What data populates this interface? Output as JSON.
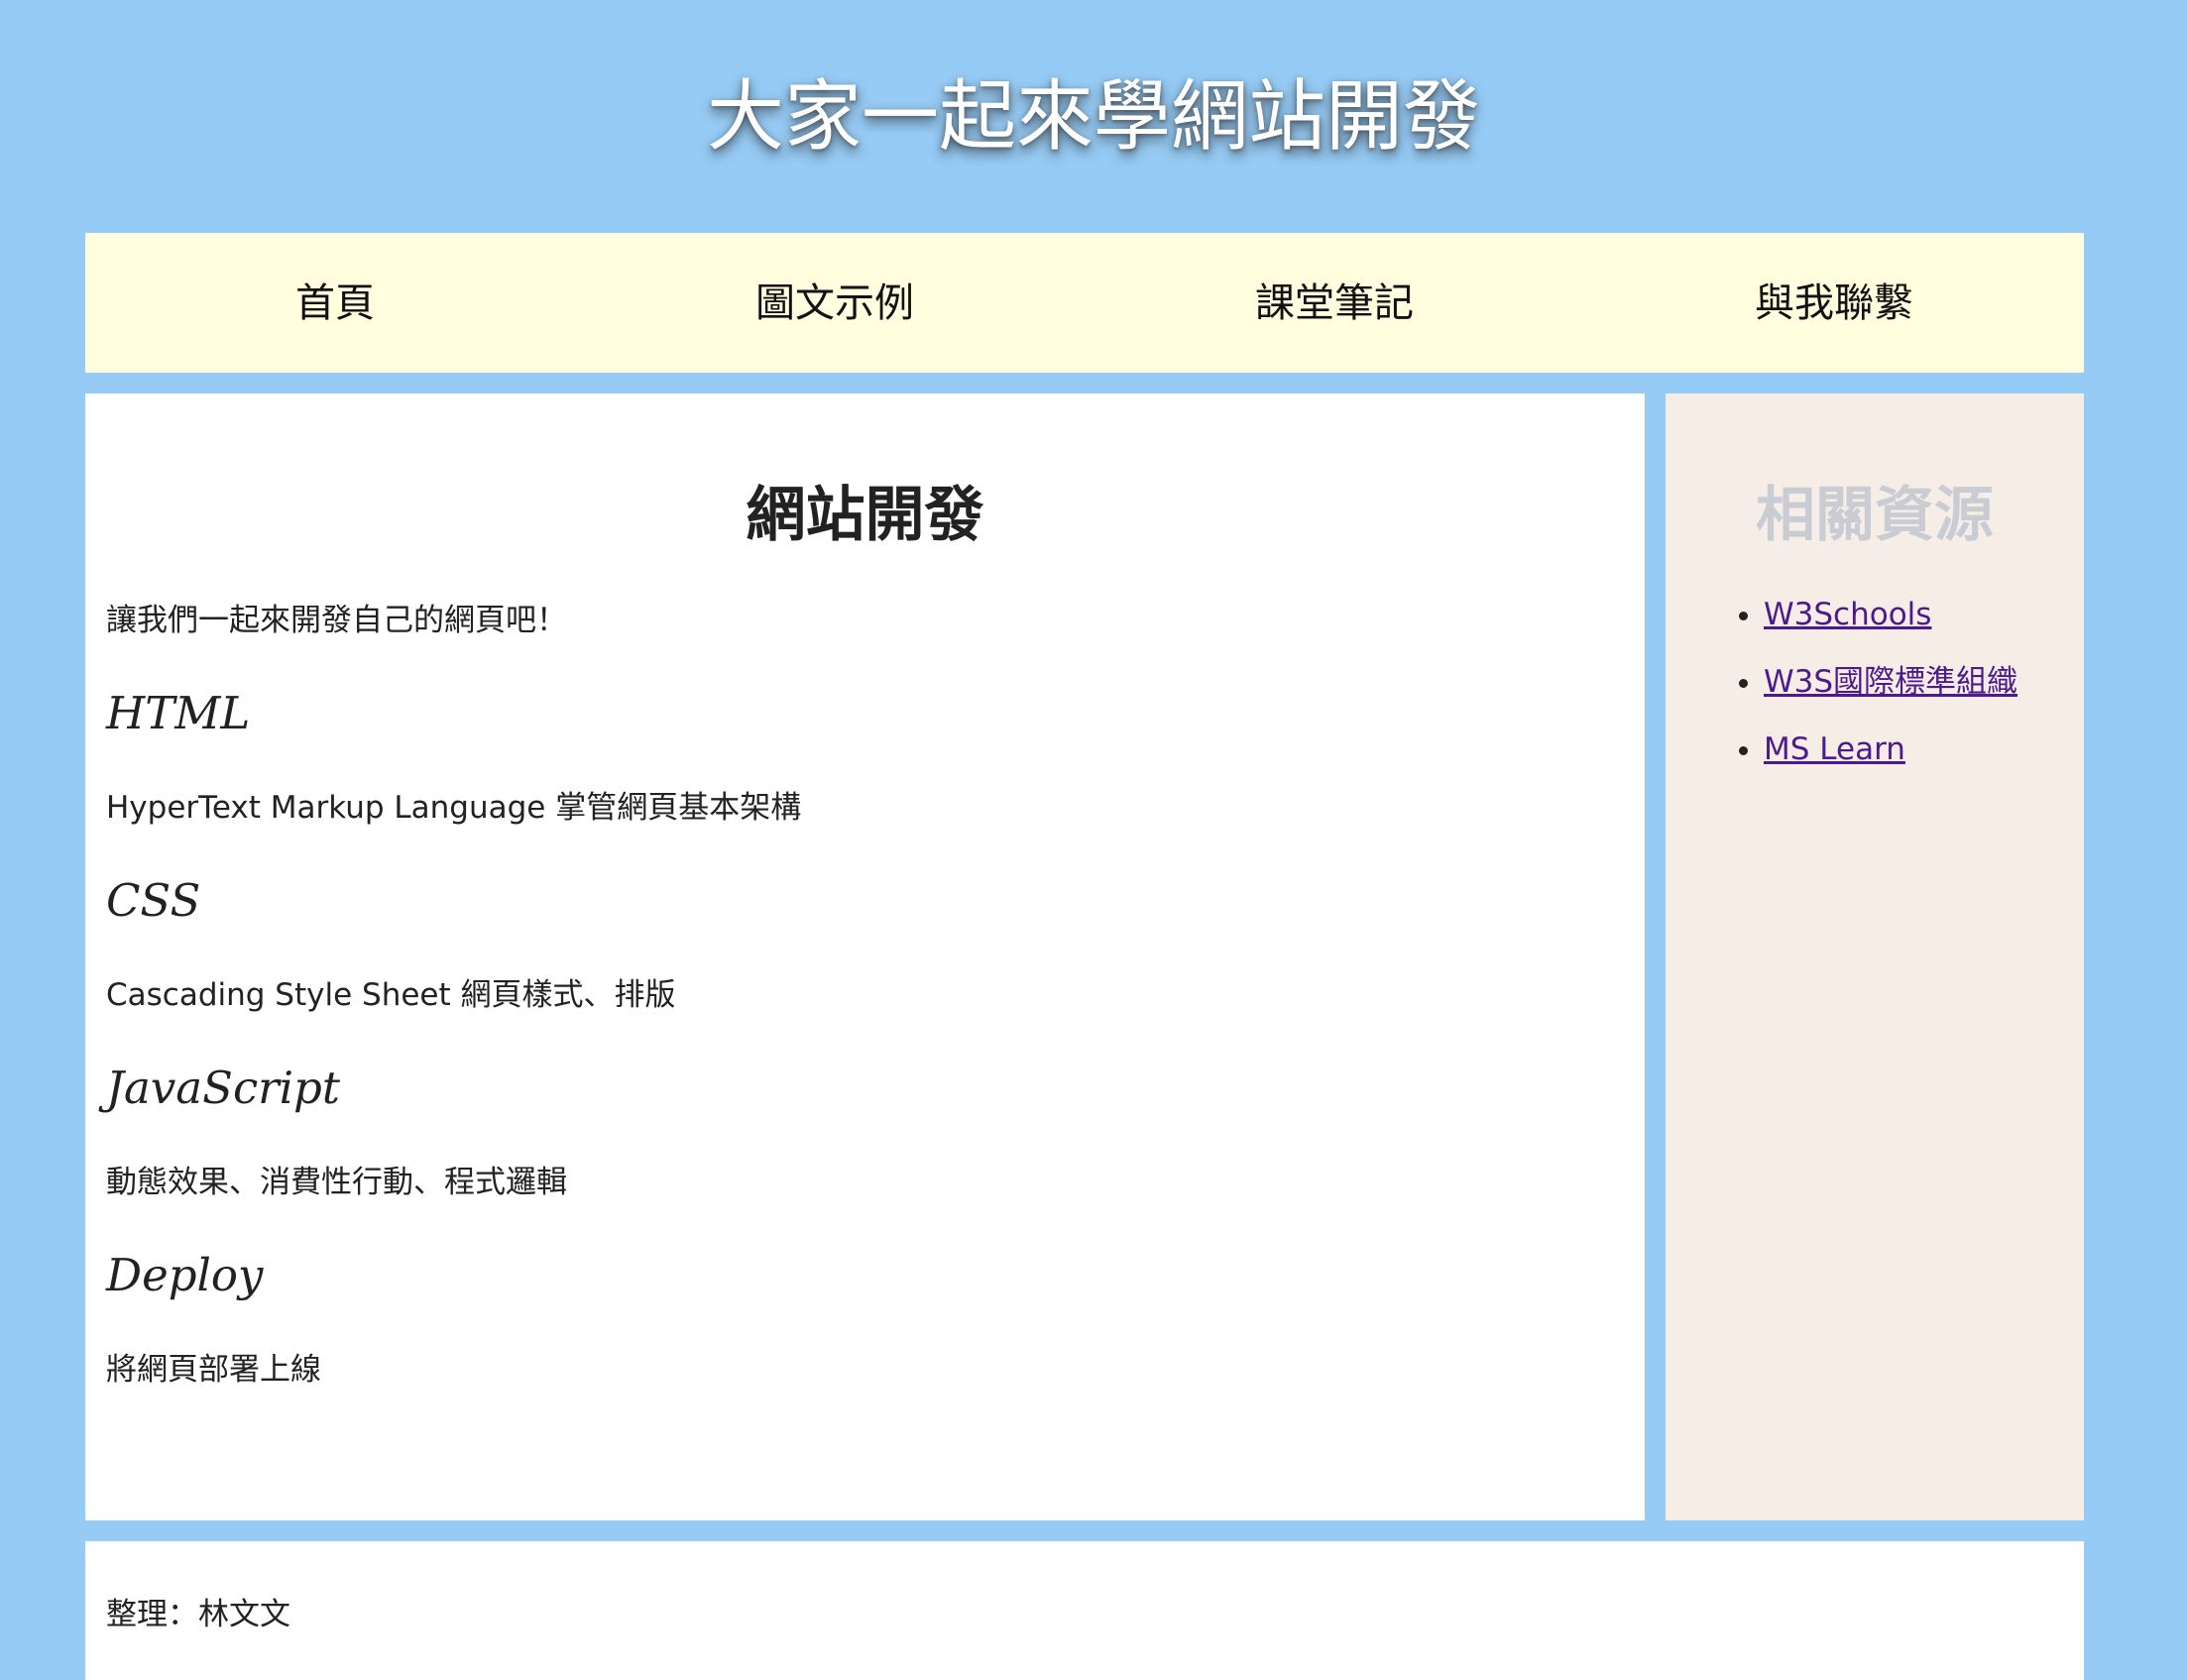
{
  "header": {
    "title": "大家一起來學網站開發"
  },
  "nav": {
    "items": [
      {
        "label": "首頁"
      },
      {
        "label": "圖文示例"
      },
      {
        "label": "課堂筆記"
      },
      {
        "label": "與我聯繫"
      }
    ]
  },
  "main": {
    "title": "網站開發",
    "intro": "讓我們一起來開發自己的網頁吧！",
    "sections": [
      {
        "heading": "HTML",
        "text": "HyperText Markup Language 掌管網頁基本架構"
      },
      {
        "heading": "CSS",
        "text": "Cascading Style Sheet 網頁樣式、排版"
      },
      {
        "heading": "JavaScript",
        "text": "動態效果、消費性行動、程式邏輯"
      },
      {
        "heading": "Deploy",
        "text": "將網頁部署上線"
      }
    ]
  },
  "aside": {
    "title": "相關資源",
    "links": [
      {
        "label": "W3Schools"
      },
      {
        "label": "W3S國際標準組織"
      },
      {
        "label": "MS Learn"
      }
    ]
  },
  "footer": {
    "credit": "整理：林文文"
  },
  "colors": {
    "page_background": "#96cbf5",
    "nav_background": "#ffffe0",
    "aside_background": "#f6eee6",
    "aside_title": "#c9cdd3",
    "link": "#4b1a8e"
  }
}
